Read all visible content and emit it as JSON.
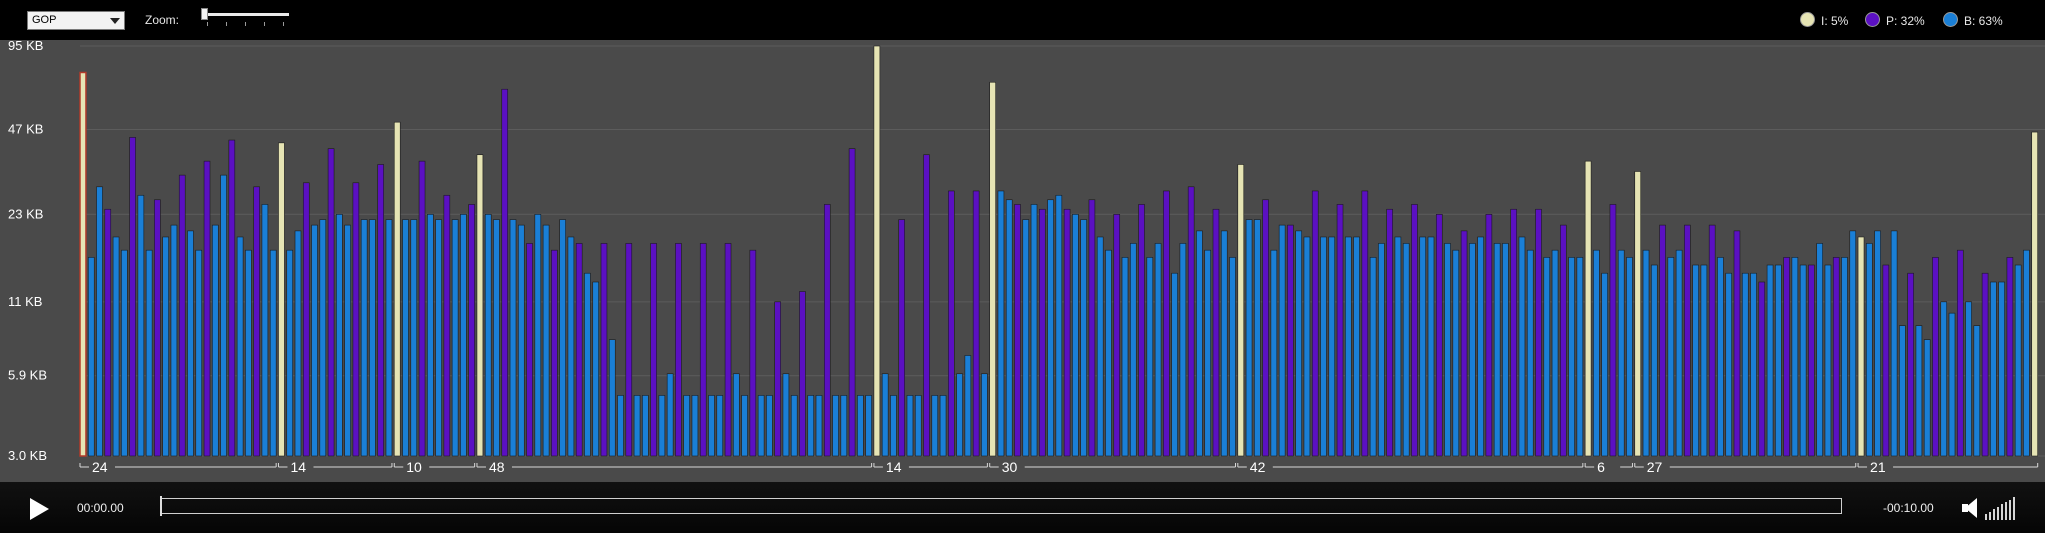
{
  "toolbar": {
    "frame_type_select": "GOP",
    "zoom_label": "Zoom:",
    "zoom_level": 0.0
  },
  "legend": [
    {
      "label": "I: 5%",
      "color": "#E6E4B4"
    },
    {
      "label": "P: 32%",
      "color": "#5B10C2"
    },
    {
      "label": "B: 63%",
      "color": "#1A7FD6"
    }
  ],
  "colors": {
    "chart_background": "#4A4A4A",
    "gridline": "#5C5C5C",
    "I": "#E6E4B4",
    "P": "#5B10C2",
    "B": "#1A7FD6",
    "first_frame_outline": "#B23A2A"
  },
  "chart_data": {
    "type": "bar",
    "y_scale": "log",
    "y_ticks": [
      "95 KB",
      "47 KB",
      "23 KB",
      "11 KB",
      "5.9 KB",
      "3.0 KB"
    ],
    "y_tick_values": [
      95,
      47,
      23,
      11,
      5.9,
      3.0
    ],
    "ylim": [
      3.0,
      95
    ],
    "legend_position": "top-right",
    "grid": true,
    "gop_labels": [
      "24",
      "14",
      "10",
      "48",
      "14",
      "30",
      "42",
      "6",
      "27",
      "21"
    ],
    "series": [
      {
        "name": "I",
        "values": [
          76,
          42,
          50,
          38,
          95,
          70,
          35,
          36,
          33,
          19,
          46
        ]
      },
      {
        "name": "P",
        "values": [
          24,
          44,
          26,
          32,
          36,
          43,
          29,
          30,
          40,
          30,
          35,
          36,
          27,
          25,
          66,
          18,
          17,
          18,
          18,
          18,
          18,
          18,
          18,
          18,
          17,
          11,
          12,
          25,
          40,
          22,
          38,
          28,
          28,
          25,
          24,
          24,
          26,
          23,
          25,
          28,
          29,
          24,
          26,
          21,
          28,
          25,
          28,
          24,
          25,
          23,
          20,
          23,
          24,
          24,
          21,
          25,
          21,
          21,
          21,
          20,
          13,
          16,
          15,
          16,
          15,
          14,
          16,
          17,
          14,
          16,
          25
        ]
      },
      {
        "name": "B",
        "values": [
          16,
          29,
          19,
          17,
          27,
          17,
          19,
          21,
          20,
          17,
          21,
          32,
          19,
          17,
          25,
          17,
          17,
          20,
          21,
          22,
          23,
          21,
          22,
          22,
          22,
          22,
          22,
          23,
          22,
          22,
          23,
          23,
          22,
          22,
          21,
          23,
          21,
          22,
          19,
          14,
          13,
          8,
          5,
          5,
          5,
          5,
          6,
          5,
          5,
          5,
          5,
          6,
          5,
          5,
          5,
          6,
          5,
          5,
          5,
          5,
          5,
          5,
          5,
          6,
          5,
          5,
          5,
          5,
          5,
          6,
          7,
          6,
          28,
          26,
          22,
          25,
          26,
          27,
          23,
          22,
          19,
          17,
          16,
          18,
          16,
          18,
          14,
          18,
          20,
          17,
          20,
          16,
          22,
          22,
          17,
          21,
          20,
          19,
          19,
          19,
          19,
          19,
          16,
          18,
          19,
          18,
          19,
          19,
          18,
          17,
          18,
          19,
          18,
          18,
          19,
          17,
          16,
          17,
          16,
          16,
          17,
          14,
          17,
          16,
          17,
          15,
          16,
          17,
          15,
          15,
          16,
          14,
          14,
          14,
          15,
          15,
          16,
          15,
          18,
          15,
          16,
          20,
          18,
          20,
          20,
          9,
          9,
          8,
          11,
          10,
          11,
          9,
          13,
          13,
          15,
          17,
          9,
          12,
          15,
          17,
          17,
          16,
          12,
          15,
          16,
          14,
          12,
          15,
          12,
          11,
          14,
          12,
          19,
          16,
          16,
          15,
          13,
          12,
          15,
          14,
          12,
          15,
          14,
          15,
          14,
          16,
          15,
          14,
          13,
          12,
          17,
          13,
          17,
          19,
          21,
          20,
          15,
          14,
          13,
          11,
          12,
          13,
          14,
          12,
          12,
          13,
          14,
          16,
          15,
          17,
          13,
          18,
          19,
          16,
          18
        ]
      }
    ]
  },
  "player": {
    "time_current": "00:00.00",
    "time_remaining": "-00:10.00",
    "progress": 0.0
  }
}
